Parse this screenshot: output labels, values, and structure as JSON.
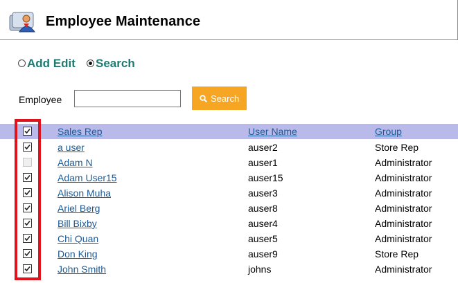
{
  "app": {
    "title": "Employee Maintenance"
  },
  "modes": [
    {
      "label": "Add Edit",
      "selected": false
    },
    {
      "label": "Search",
      "selected": true
    }
  ],
  "filter": {
    "label": "Employee",
    "value": "",
    "button_label": "Search"
  },
  "table": {
    "columns": [
      "Sales Rep",
      "User Name",
      "Group"
    ],
    "header_checked": true,
    "rows": [
      {
        "checked": true,
        "enabled": true,
        "name": "a user",
        "username": "auser2",
        "group": "Store Rep"
      },
      {
        "checked": false,
        "enabled": false,
        "name": "Adam N",
        "username": "auser1",
        "group": "Administrator"
      },
      {
        "checked": true,
        "enabled": true,
        "name": "Adam User15",
        "username": "auser15",
        "group": "Administrator"
      },
      {
        "checked": true,
        "enabled": true,
        "name": "Alison Muha",
        "username": "auser3",
        "group": "Administrator"
      },
      {
        "checked": true,
        "enabled": true,
        "name": "Ariel Berg",
        "username": "auser8",
        "group": "Administrator"
      },
      {
        "checked": true,
        "enabled": true,
        "name": "Bill Bixby",
        "username": "auser4",
        "group": "Administrator"
      },
      {
        "checked": true,
        "enabled": true,
        "name": "Chi Quan",
        "username": "auser5",
        "group": "Administrator"
      },
      {
        "checked": true,
        "enabled": true,
        "name": "Don King",
        "username": "auser9",
        "group": "Store Rep"
      },
      {
        "checked": true,
        "enabled": true,
        "name": "John Smith",
        "username": "johns",
        "group": "Administrator"
      }
    ]
  },
  "colors": {
    "accent": "#f6a623",
    "mode_text": "#1f7a72",
    "header_row": "#b9b9ea",
    "link": "#1b5a96",
    "highlight": "#e0121b"
  },
  "icons": {
    "logo": "employee-app-icon",
    "search": "search-icon",
    "check": "check-icon"
  }
}
